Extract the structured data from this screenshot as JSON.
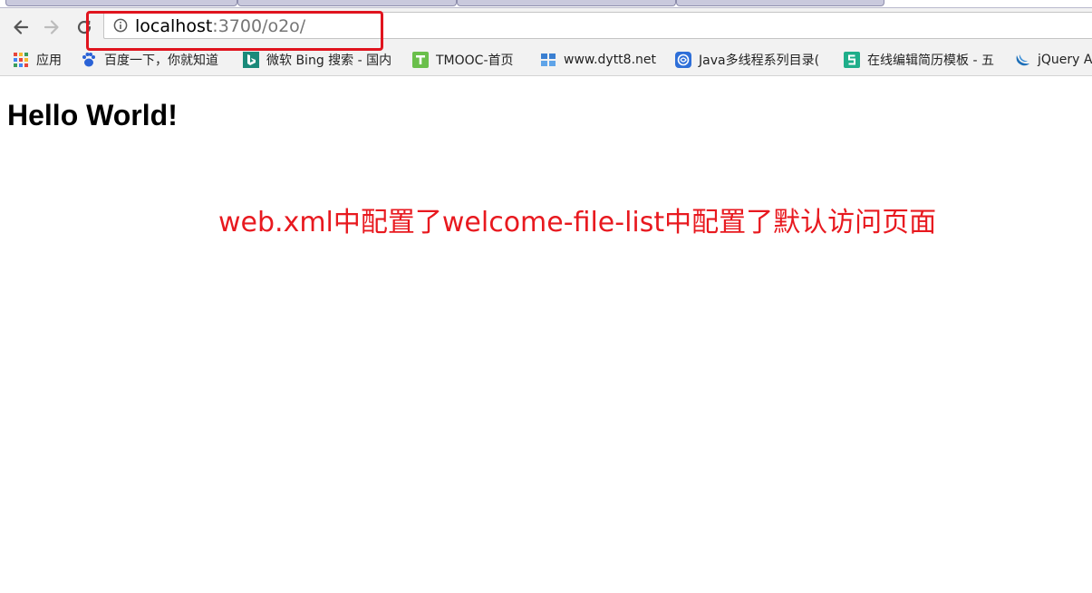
{
  "browser": {
    "address_bar": {
      "host": "localhost",
      "path": ":3700/o2o/"
    },
    "bookmarks": [
      {
        "label": "应用",
        "icon": "apps-grid-icon"
      },
      {
        "label": "百度一下，你就知道",
        "icon": "baidu-paw-icon"
      },
      {
        "label": "微软 Bing 搜索 - 国内",
        "icon": "bing-icon"
      },
      {
        "label": "TMOOC-首页",
        "icon": "tmooc-icon"
      },
      {
        "label": "www.dytt8.net",
        "icon": "dytt-icon"
      },
      {
        "label": "Java多线程系列目录(",
        "icon": "java-icon"
      },
      {
        "label": "在线编辑简历模板 - 五",
        "icon": "resume-icon"
      },
      {
        "label": "jQuery A",
        "icon": "jquery-icon"
      }
    ]
  },
  "page": {
    "heading": "Hello World!"
  },
  "annotation": {
    "text": "web.xml中配置了welcome-file-list中配置了默认访问页面",
    "color": "#e8191f"
  },
  "colors": {
    "highlight_box": "#e0141e",
    "chrome_bg": "#f2f2f2"
  }
}
